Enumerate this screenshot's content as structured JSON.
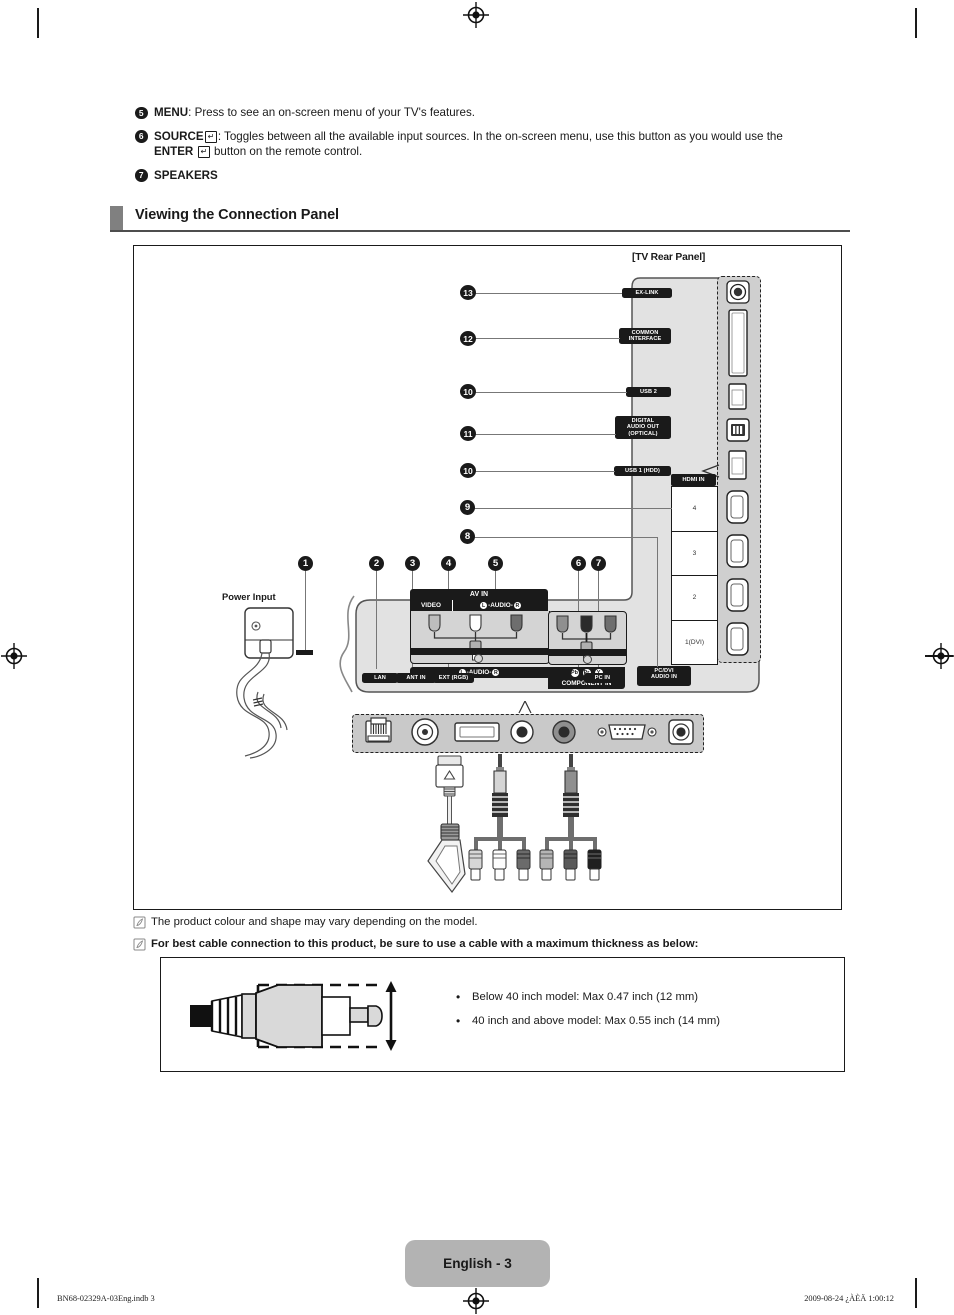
{
  "bullets": [
    {
      "num": "5",
      "bold": "MENU",
      "rest": ": Press to see an on-screen menu of your TV's features."
    },
    {
      "num": "6",
      "bold": "SOURCE",
      "rest": ": Toggles between all the available input sources. In the on-screen menu, use this button as you would use the",
      "bold2": "ENTER",
      "rest2": "button on the remote control."
    },
    {
      "num": "7",
      "bold": "SPEAKERS",
      "rest": ""
    }
  ],
  "section": {
    "title": "Viewing the Connection Panel"
  },
  "diagram": {
    "rear_panel_label": "[TV Rear Panel]",
    "power_input_label": "Power Input",
    "side_ports": [
      {
        "num": "13",
        "label": "EX-LINK"
      },
      {
        "num": "12",
        "label": "COMMON\nINTERFACE"
      },
      {
        "num": "10",
        "label": "USB 2"
      },
      {
        "num": "11",
        "label": "DIGITAL\nAUDIO OUT\n(OPTICAL)"
      },
      {
        "num": "10",
        "label": "USB 1 (HDD)"
      }
    ],
    "side_port_labels": {
      "exlink": "EX-LINK",
      "common_interface": "COMMON INTERFACE",
      "usb2": "USB 2",
      "digital_audio_out": "DIGITAL AUDIO OUT (OPTICAL)",
      "usb1_hdd": "USB 1 (HDD)"
    },
    "hdmi": {
      "header": "HDMI IN",
      "cells": [
        "4",
        "3",
        "2",
        "1(DVI)"
      ],
      "callout": "9"
    },
    "bottom_ports": [
      {
        "num": "2",
        "label": "LAN"
      },
      {
        "num": "3",
        "label": "ANT IN"
      },
      {
        "num": "4",
        "label": "EXT (RGB)"
      },
      {
        "num": "6",
        "label": "COMPONENT IN"
      },
      {
        "num": "7",
        "label": "PC IN"
      },
      {
        "num": "8",
        "label": "PC/DVI AUDIO IN"
      }
    ],
    "av_in": {
      "callout": "5",
      "title": "AV IN",
      "video": "VIDEO",
      "audio": "AUDIO",
      "audio_left": "L",
      "audio_right": "R",
      "component_in": "COMPONENT IN",
      "comp_pb": "Pb",
      "comp_pr": "Pr",
      "comp_y": "Y"
    },
    "callout_1": "1",
    "labels": {
      "lan": "LAN",
      "ant_in": "ANT IN",
      "ext_rgb": "EXT (RGB)",
      "pc_in": "PC IN",
      "pc_dvi_audio_in": "PC/DVI\nAUDIO IN"
    }
  },
  "notes": [
    {
      "text": "The product colour and shape may vary depending on the model.",
      "bold": false
    },
    {
      "text": "For best cable connection to this product, be sure to use a cable with a maximum thickness as below:",
      "bold": true
    }
  ],
  "thickness": {
    "items": [
      "Below 40 inch model: Max 0.47 inch (12 mm)",
      "40 inch and above model: Max 0.55 inch (14 mm)"
    ]
  },
  "footer": {
    "page": "English - 3",
    "left": "BN68-02329A-03Eng.indb   3",
    "right": "2009-08-24   ¿ÀÈÄ 1:00:12"
  },
  "colors": {
    "accent_gray": "#808080",
    "panel_gray": "#d4d4d4",
    "chip_black": "#1a1a1a",
    "badge_gray": "#b3b3b3"
  }
}
